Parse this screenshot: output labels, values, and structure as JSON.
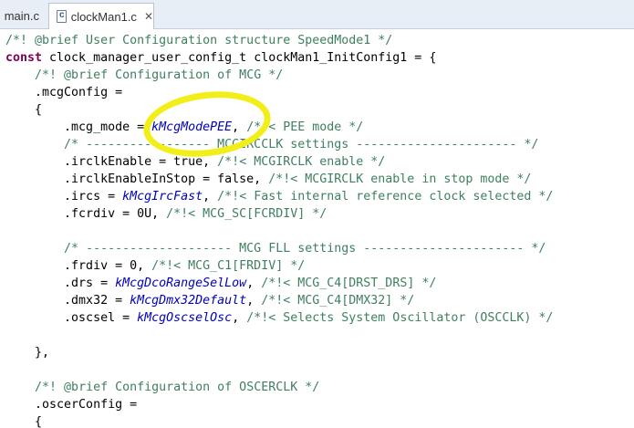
{
  "tabs": [
    {
      "label": "main.c",
      "icon": "c-file-icon",
      "active": false
    },
    {
      "label": "clockMan1.c",
      "icon": "c-file-icon",
      "active": true
    }
  ],
  "close_glyph": "✕",
  "file_icon_letter": "c",
  "code_lines": [
    [
      {
        "t": "/*! @brief User Configuration structure SpeedMode1 */",
        "c": "cm"
      }
    ],
    [
      {
        "t": "const",
        "c": "kw"
      },
      {
        "t": " clock_manager_user_config_t clockMan1_InitConfig1 = {",
        "c": ""
      }
    ],
    [
      {
        "t": "    ",
        "c": ""
      },
      {
        "t": "/*! @brief Configuration of MCG */",
        "c": "cm"
      }
    ],
    [
      {
        "t": "    .mcgConfig =",
        "c": ""
      }
    ],
    [
      {
        "t": "    {",
        "c": ""
      }
    ],
    [
      {
        "t": "        .mcg_mode = ",
        "c": ""
      },
      {
        "t": "kMcgModePEE",
        "c": "en"
      },
      {
        "t": ", ",
        "c": ""
      },
      {
        "t": "/*!< PEE mode */",
        "c": "cm"
      }
    ],
    [
      {
        "t": "        ",
        "c": ""
      },
      {
        "t": "/* ----------------- MCGIRCCLK settings ---------------------- */",
        "c": "cm"
      }
    ],
    [
      {
        "t": "        .irclkEnable = true, ",
        "c": ""
      },
      {
        "t": "/*!< MCGIRCLK enable */",
        "c": "cm"
      }
    ],
    [
      {
        "t": "        .irclkEnableInStop = false, ",
        "c": ""
      },
      {
        "t": "/*!< MCGIRCLK enable in stop mode */",
        "c": "cm"
      }
    ],
    [
      {
        "t": "        .ircs = ",
        "c": ""
      },
      {
        "t": "kMcgIrcFast",
        "c": "en"
      },
      {
        "t": ", ",
        "c": ""
      },
      {
        "t": "/*!< Fast internal reference clock selected */",
        "c": "cm"
      }
    ],
    [
      {
        "t": "        .fcrdiv = 0U, ",
        "c": ""
      },
      {
        "t": "/*!< MCG_SC[FCRDIV] */",
        "c": "cm"
      }
    ],
    [
      {
        "t": "",
        "c": ""
      }
    ],
    [
      {
        "t": "        ",
        "c": ""
      },
      {
        "t": "/* -------------------- MCG FLL settings ---------------------- */",
        "c": "cm"
      }
    ],
    [
      {
        "t": "        .frdiv = 0, ",
        "c": ""
      },
      {
        "t": "/*!< MCG_C1[FRDIV] */",
        "c": "cm"
      }
    ],
    [
      {
        "t": "        .drs = ",
        "c": ""
      },
      {
        "t": "kMcgDcoRangeSelLow",
        "c": "en"
      },
      {
        "t": ", ",
        "c": ""
      },
      {
        "t": "/*!< MCG_C4[DRST_DRS] */",
        "c": "cm"
      }
    ],
    [
      {
        "t": "        .dmx32 = ",
        "c": ""
      },
      {
        "t": "kMcgDmx32Default",
        "c": "en"
      },
      {
        "t": ", ",
        "c": ""
      },
      {
        "t": "/*!< MCG_C4[DMX32] */",
        "c": "cm"
      }
    ],
    [
      {
        "t": "        .oscsel = ",
        "c": ""
      },
      {
        "t": "kMcgOscselOsc",
        "c": "en"
      },
      {
        "t": ", ",
        "c": ""
      },
      {
        "t": "/*!< Selects System Oscillator (OSCCLK) */",
        "c": "cm"
      }
    ],
    [
      {
        "t": "",
        "c": ""
      }
    ],
    [
      {
        "t": "    },",
        "c": ""
      }
    ],
    [
      {
        "t": "",
        "c": ""
      }
    ],
    [
      {
        "t": "    ",
        "c": ""
      },
      {
        "t": "/*! @brief Configuration of OSCERCLK */",
        "c": "cm"
      }
    ],
    [
      {
        "t": "    .oscerConfig =",
        "c": ""
      }
    ],
    [
      {
        "t": "    {",
        "c": ""
      }
    ]
  ],
  "colors": {
    "comment": "#3f7f5f",
    "keyword": "#7f0055",
    "enum_constant": "#0000c0",
    "highlight_marker": "#f2ee1a",
    "tabbar_bg": "#e8eef6"
  }
}
